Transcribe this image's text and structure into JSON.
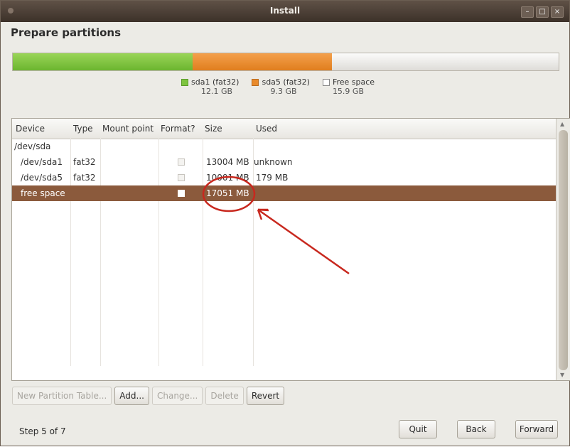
{
  "window": {
    "title": "Install"
  },
  "page": {
    "heading": "Prepare partitions"
  },
  "partition_bar": [
    {
      "name": "sda1 (fat32)",
      "size": "12.1 GB",
      "color": "#7dc43f"
    },
    {
      "name": "sda5 (fat32)",
      "size": "9.3 GB",
      "color": "#e98a2b"
    },
    {
      "name": "Free space",
      "size": "15.9 GB",
      "color": "#ffffff"
    }
  ],
  "table": {
    "columns": [
      "Device",
      "Type",
      "Mount point",
      "Format?",
      "Size",
      "Used"
    ],
    "rows": [
      {
        "device": "/dev/sda",
        "type": "",
        "mount": "",
        "size": "",
        "used": ""
      },
      {
        "device": "/dev/sda1",
        "type": "fat32",
        "mount": "",
        "size": "13004 MB",
        "used": "unknown"
      },
      {
        "device": "/dev/sda5",
        "type": "fat32",
        "mount": "",
        "size": "10001 MB",
        "used": "179 MB"
      },
      {
        "device": "free space",
        "type": "",
        "mount": "",
        "size": "17051 MB",
        "used": ""
      }
    ]
  },
  "buttons": {
    "new_partition_table": "New Partition Table...",
    "add": "Add...",
    "change": "Change...",
    "delete": "Delete",
    "revert": "Revert"
  },
  "footer": {
    "step": "Step 5 of 7",
    "quit": "Quit",
    "back": "Back",
    "forward": "Forward"
  },
  "annotation": {
    "color": "#c8281e"
  },
  "colors": {
    "accent_selected": "#8b5a3c"
  }
}
